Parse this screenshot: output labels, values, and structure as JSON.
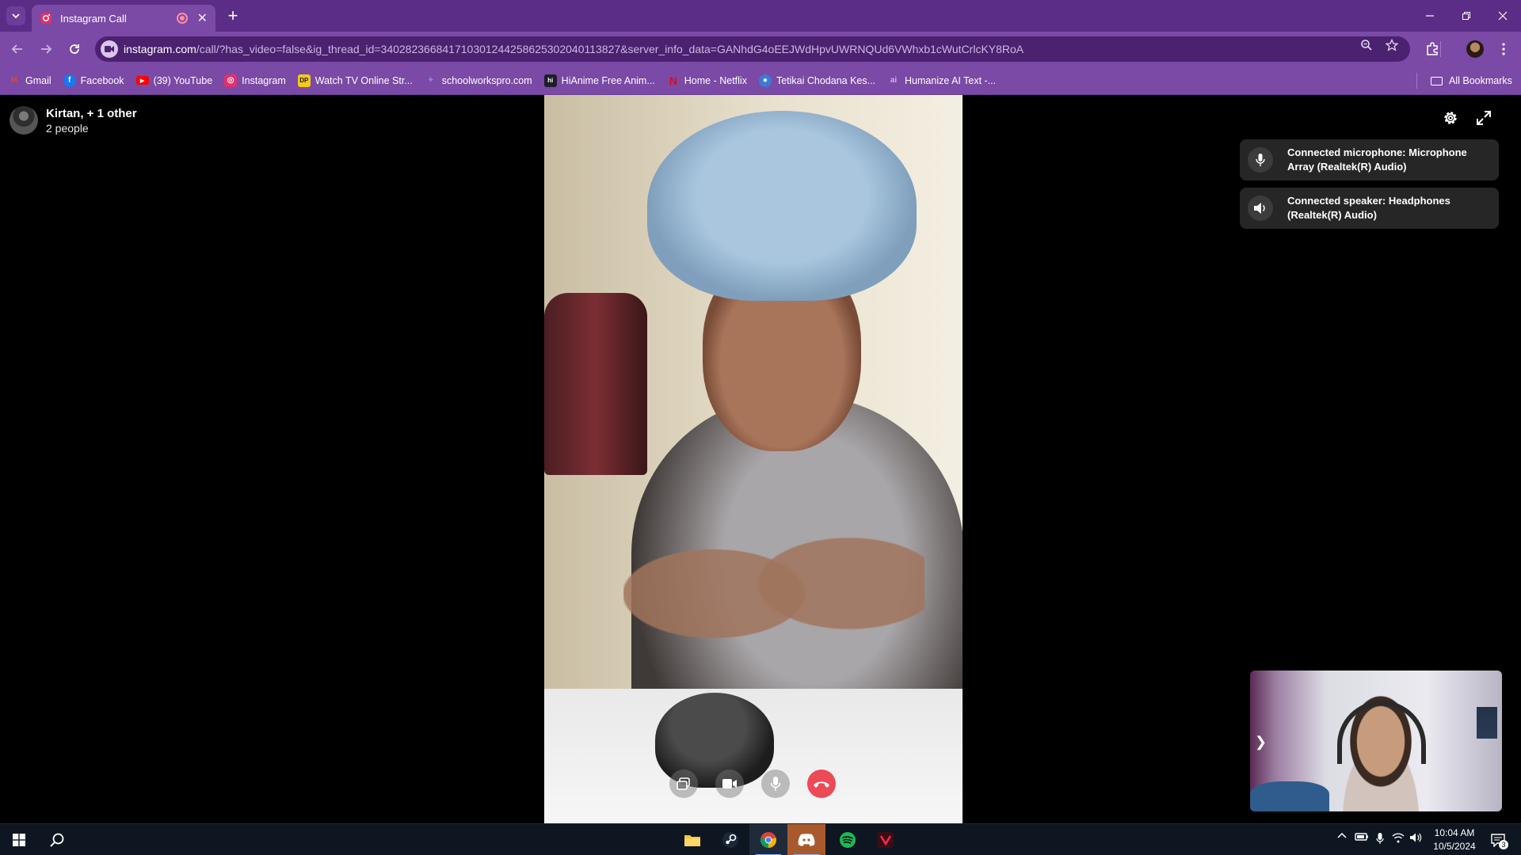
{
  "browser": {
    "tab": {
      "title": "Instagram Call"
    },
    "url": {
      "host": "instagram.com",
      "rest": "/call/?has_video=false&ig_thread_id=340282366841710301244258625302040113827&server_info_data=GANhdG4oEEJWdHpvUWRNQUd6VWhxb1cWutCrlcKY8RoA"
    },
    "bookmarks": [
      {
        "label": "Gmail",
        "icon": "gmail-icon",
        "color": "#ea4335"
      },
      {
        "label": "Facebook",
        "icon": "facebook-icon",
        "color": "#1877f2"
      },
      {
        "label": "(39) YouTube",
        "icon": "youtube-icon",
        "color": "#ff0000"
      },
      {
        "label": "Instagram",
        "icon": "instagram-icon",
        "color": "#e1306c"
      },
      {
        "label": "Watch TV Online Str...",
        "icon": "watch-tv-icon",
        "color": "#f6c915"
      },
      {
        "label": "schoolworkspro.com",
        "icon": "schoolworks-icon",
        "color": "#5f4bd8"
      },
      {
        "label": "HiAnime Free Anim...",
        "icon": "hianime-icon",
        "color": "#1e1e2a"
      },
      {
        "label": "Home - Netflix",
        "icon": "netflix-icon",
        "color": "#e50914"
      },
      {
        "label": "Tetikai Chodana Kes...",
        "icon": "tetikai-icon",
        "color": "#3a7bd5"
      },
      {
        "label": "Humanize AI Text -...",
        "icon": "humanize-icon",
        "color": "#9a86c7"
      }
    ],
    "all_bookmarks": "All Bookmarks"
  },
  "call": {
    "participants_title": "Kirtan, + 1 other",
    "participants_count": "2 people",
    "notifications": [
      {
        "icon": "microphone-icon",
        "text": "Connected microphone: Microphone Array (Realtek(R) Audio)"
      },
      {
        "icon": "speaker-icon",
        "text": "Connected speaker: Headphones (Realtek(R) Audio)"
      }
    ]
  },
  "taskbar": {
    "time": "10:04 AM",
    "date": "10/5/2024",
    "notification_count": "3"
  },
  "colors": {
    "tabbar": "#5b2d86",
    "toolbar": "#7a4aa6",
    "end_call": "#ed4956",
    "toast_bg": "#262626"
  }
}
